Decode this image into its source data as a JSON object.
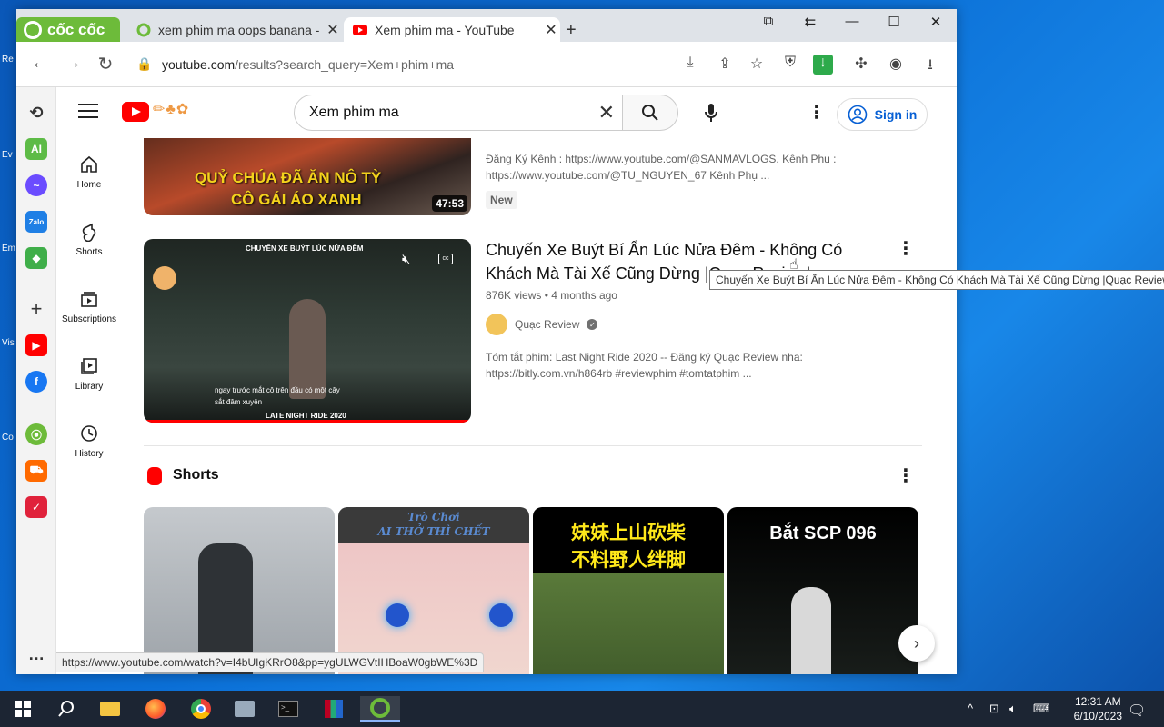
{
  "browser": {
    "brand": "cốc cốc",
    "tabs": [
      {
        "title": "xem phim ma oops banana -",
        "active": false
      },
      {
        "title": "Xem phim ma - YouTube",
        "active": true
      }
    ],
    "url_host": "youtube.com",
    "url_rest": "/results?search_query=Xem+phim+ma",
    "rail_labels": {
      "ai": "AI",
      "zalo": "Zalo"
    }
  },
  "youtube": {
    "search_value": "Xem phim ma",
    "signin_label": "Sign in",
    "guide": [
      {
        "label": "Home"
      },
      {
        "label": "Shorts"
      },
      {
        "label": "Subscriptions"
      },
      {
        "label": "Library"
      },
      {
        "label": "History"
      }
    ],
    "video1": {
      "thumb_text_1": "QUỶ CHÚA ĐÃ ĂN NÔ TỲ",
      "thumb_text_2": "CÔ GÁI ÁO XANH",
      "duration": "47:53",
      "desc_1": "Đăng Ký Kênh : https://www.youtube.com/@SANMAVLOGS. Kênh Phụ :",
      "desc_2": "https://www.youtube.com/@TU_NGUYEN_67 Kênh Phụ ...",
      "badge": "New"
    },
    "video2": {
      "title_1": "Chuyến Xe Buýt Bí Ẩn Lúc Nửa Đêm - Không Có",
      "title_2": "Khách Mà Tài Xế Cũng Dừng |Quạc Review|",
      "views": "876K views",
      "age": "4 months ago",
      "channel": "Quạc Review",
      "desc_1": "Tóm tắt phim: Last Night Ride 2020 -- Đăng ký Quạc Review nha:",
      "desc_2": "https://bitly.com.vn/h864rb #reviewphim #tomtatphim ...",
      "thumb_top": "CHUYẾN XE BUÝT LÚC NỬA ĐÊM",
      "thumb_sub_1": "ngay trước mắt cô trên đầu có một cây",
      "thumb_sub_2": "sắt đâm xuyên",
      "thumb_bottom": "LATE NIGHT RIDE 2020"
    },
    "shorts_heading": "Shorts",
    "shorts": [
      {
        "caption": ""
      },
      {
        "caption_1": "Trò Chơi",
        "caption_2": "AI THỞ THÌ CHẾT"
      },
      {
        "caption_1": "妹妹上山砍柴",
        "caption_2": "不料野人绊脚"
      },
      {
        "caption_1": "Bắt SCP 096"
      }
    ],
    "tooltip": "Chuyến Xe Buýt Bí Ẩn Lúc Nửa Đêm - Không Có Khách Mà Tài Xế Cũng Dừng |Quạc Review|",
    "status_url": "https://www.youtube.com/watch?v=I4bUIgKRrO8&pp=ygULWGVtIHBoaW0gbWE%3D"
  },
  "taskbar": {
    "time": "12:31 AM",
    "date": "6/10/2023"
  },
  "colors": {
    "yt_red": "#ff0000",
    "coccoc_green": "#6dbb3a",
    "signin_blue": "#065fd4",
    "taskbar": "#1c2533"
  }
}
